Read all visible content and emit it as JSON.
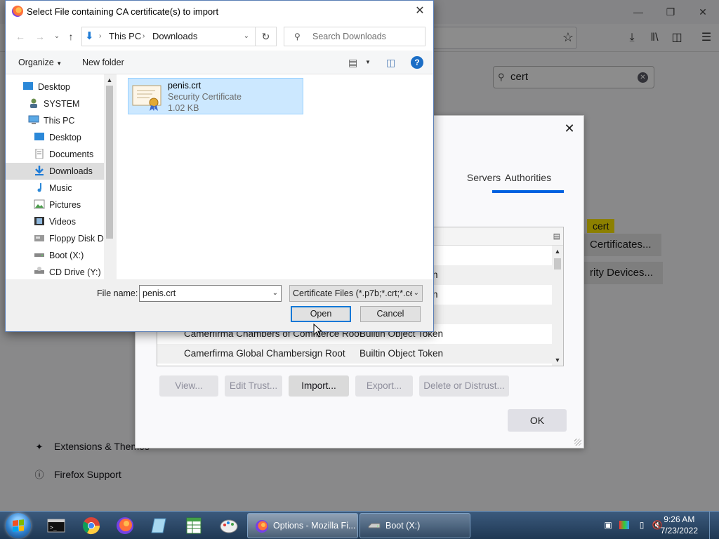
{
  "firefox": {
    "search_value": "cert",
    "highlight_text": "cert",
    "certificates_button": "Certificates...",
    "security_devices_button": "rity Devices...",
    "extensions_link": "Extensions & Themes",
    "support_link": "Firefox Support"
  },
  "cert_manager": {
    "tabs": [
      {
        "label": "Servers"
      },
      {
        "label": "Authorities",
        "active": true
      }
    ],
    "rows": [
      {
        "name": "",
        "token": ""
      },
      {
        "name": "",
        "token": "n"
      },
      {
        "name": "",
        "token": "n"
      },
      {
        "name": "",
        "token": ""
      },
      {
        "name": "Camerfirma Chambers of Commerce Root",
        "token": "Builtin Object Token"
      },
      {
        "name": "Camerfirma Global Chambersign Root",
        "token": "Builtin Object Token"
      }
    ],
    "buttons": {
      "view": "View...",
      "edit_trust": "Edit Trust...",
      "import": "Import...",
      "export": "Export...",
      "delete": "Delete or Distrust..."
    },
    "ok": "OK"
  },
  "file_dialog": {
    "title": "Select File containing CA certificate(s) to import",
    "breadcrumb": [
      "This PC",
      "Downloads"
    ],
    "search_placeholder": "Search Downloads",
    "organize": "Organize",
    "new_folder": "New folder",
    "nav_items": [
      {
        "label": "Desktop",
        "icon": "desktop-icon",
        "indent": 0
      },
      {
        "label": "SYSTEM",
        "icon": "user-icon",
        "indent": 1
      },
      {
        "label": "This PC",
        "icon": "computer-icon",
        "indent": 1
      },
      {
        "label": "Desktop",
        "icon": "desktop-icon",
        "indent": 2
      },
      {
        "label": "Documents",
        "icon": "documents-icon",
        "indent": 2
      },
      {
        "label": "Downloads",
        "icon": "downloads-icon",
        "indent": 2,
        "selected": true
      },
      {
        "label": "Music",
        "icon": "music-icon",
        "indent": 2
      },
      {
        "label": "Pictures",
        "icon": "pictures-icon",
        "indent": 2
      },
      {
        "label": "Videos",
        "icon": "videos-icon",
        "indent": 2
      },
      {
        "label": "Floppy Disk Dri",
        "icon": "floppy-icon",
        "indent": 2
      },
      {
        "label": "Boot (X:)",
        "icon": "drive-icon",
        "indent": 2
      },
      {
        "label": "CD Drive (Y:) H",
        "icon": "cd-drive-icon",
        "indent": 2
      }
    ],
    "file": {
      "name": "penis.crt",
      "type": "Security Certificate",
      "size": "1.02 KB"
    },
    "file_name_label": "File name:",
    "file_name_value": "penis.crt",
    "file_type": "Certificate Files (*.p7b;*.crt;*.ce",
    "open": "Open",
    "cancel": "Cancel"
  },
  "taskbar": {
    "tasks": [
      {
        "label": "Options - Mozilla Fi...",
        "active": true
      },
      {
        "label": "Boot (X:)",
        "active": false
      }
    ],
    "time": "9:26 AM",
    "date": "7/23/2022"
  }
}
